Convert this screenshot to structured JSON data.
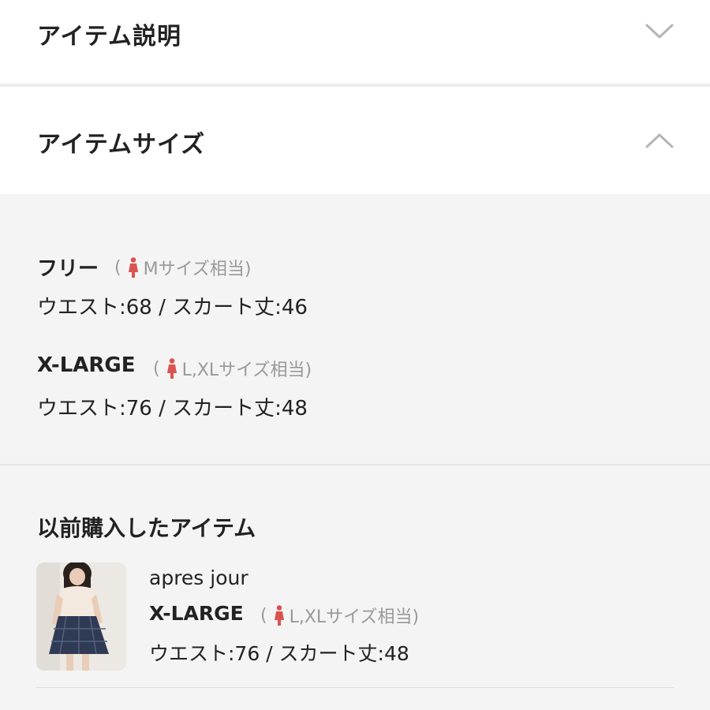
{
  "accordion": {
    "description": {
      "title": "アイテム説明",
      "state": "collapsed",
      "icon": "chevron-down-icon"
    },
    "size": {
      "title": "アイテムサイズ",
      "state": "expanded",
      "icon": "chevron-up-icon"
    }
  },
  "sizes": [
    {
      "label": "フリー",
      "note_open": "(",
      "note": "Mサイズ相当)",
      "measure": "ウエスト:68 / スカート丈:46"
    },
    {
      "label": "X-LARGE",
      "note_open": "(",
      "note": "L,XLサイズ相当)",
      "measure": "ウエスト:76 / スカート丈:48"
    }
  ],
  "history": {
    "heading": "以前購入したアイテム",
    "items": [
      {
        "brand": "apres jour",
        "size": "X-LARGE",
        "note_open": "(",
        "note": "L,XLサイズ相当)",
        "measure": "ウエスト:76 / スカート丈:48"
      }
    ]
  },
  "colors": {
    "accent_icon": "#d9534f",
    "muted": "#999999",
    "panel_bg": "#f4f4f4"
  }
}
